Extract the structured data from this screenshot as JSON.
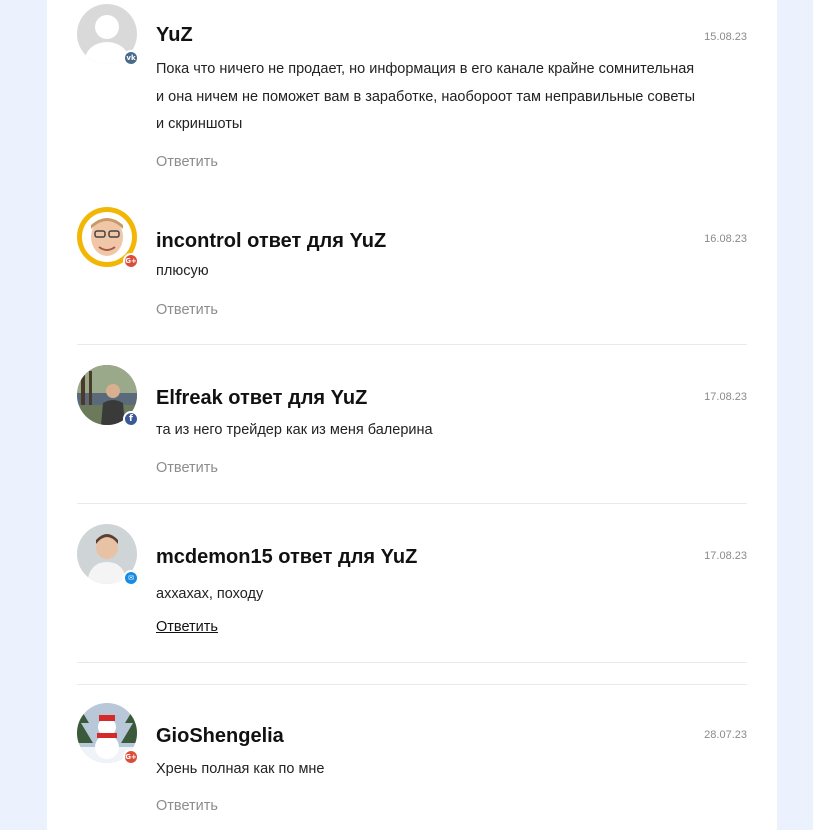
{
  "comments": [
    {
      "name": "YuZ",
      "date": "15.08.23",
      "text": "Пока что ничего не продает, но информация в его канале крайне сомнительная и она ничем не поможет вам в заработке, наобороот там неправильные советы и скриншоты",
      "reply": "Ответить",
      "network": "vk",
      "badge_color": "#4a6a8a"
    },
    {
      "name": "incontrol ответ для YuZ",
      "date": "16.08.23",
      "text": "плюсую",
      "reply": "Ответить",
      "network": "google-plus",
      "badge_color": "#dd4b39"
    },
    {
      "name": "Elfreak ответ для YuZ",
      "date": "17.08.23",
      "text": "та из него трейдер как из меня балерина",
      "reply": "Ответить",
      "network": "facebook",
      "badge_color": "#3b5998"
    },
    {
      "name": "mcdemon15 ответ для YuZ",
      "date": "17.08.23",
      "text": "аххахах, походу",
      "reply": "Ответить",
      "network": "mail",
      "badge_color": "#168de2"
    },
    {
      "name": "GioShengelia",
      "date": "28.07.23",
      "text": "Хрень полная как по мне",
      "reply": "Ответить",
      "network": "google-plus",
      "badge_color": "#dd4b39"
    }
  ]
}
